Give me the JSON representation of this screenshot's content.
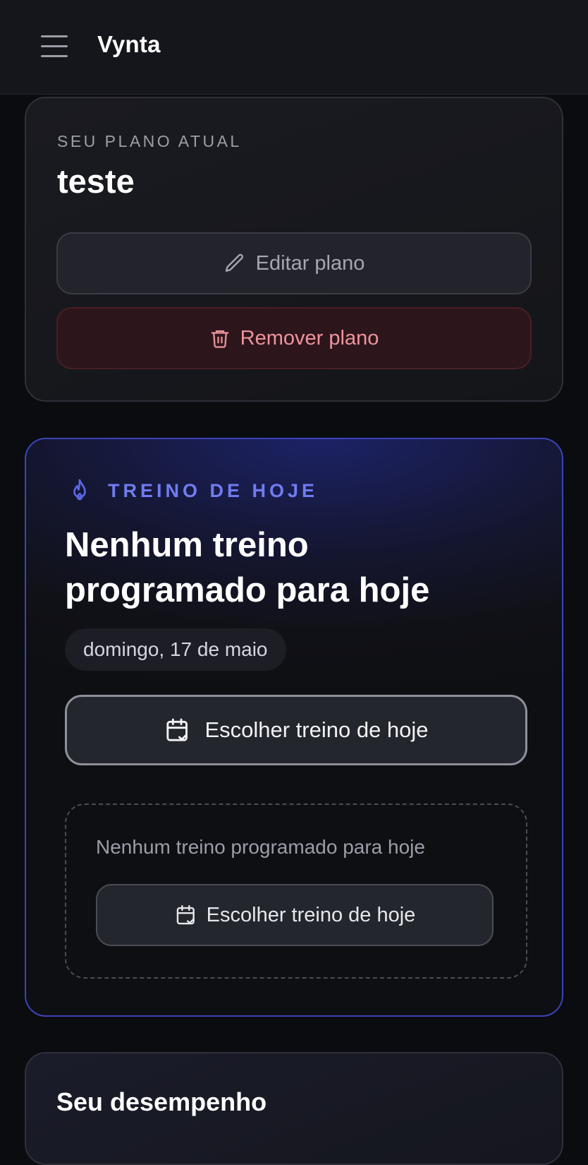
{
  "app": {
    "brand": "Vynta"
  },
  "plan_card": {
    "eyebrow": "SEU PLANO ATUAL",
    "plan_name": "teste",
    "edit_label": "Editar plano",
    "remove_label": "Remover plano"
  },
  "today_card": {
    "eyebrow": "TREINO DE HOJE",
    "title": "Nenhum treino programado para hoje",
    "date": "domingo, 17 de maio",
    "choose_label": "Escolher treino de hoje",
    "empty_text": "Nenhum treino programado para hoje",
    "empty_choose_label": "Escolher treino de hoje"
  },
  "performance_card": {
    "title": "Seu desempenho"
  },
  "colors": {
    "accent": "#6f7cf0",
    "accent_border": "#3a44b8",
    "danger_text": "#f0939c",
    "background": "#0b0c10"
  },
  "icons": [
    "menu-icon",
    "pencil-icon",
    "trash-icon",
    "flame-icon",
    "calendar-check-icon"
  ]
}
